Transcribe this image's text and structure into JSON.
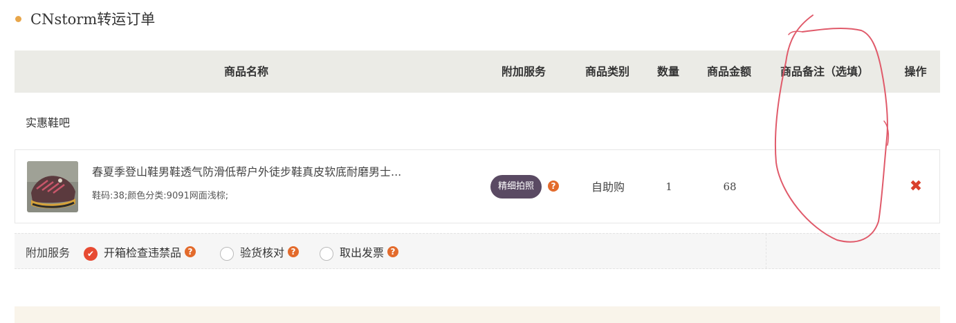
{
  "section": {
    "title": "CNstorm转运订单"
  },
  "table": {
    "headers": {
      "name": "商品名称",
      "service": "附加服务",
      "category": "商品类别",
      "qty": "数量",
      "amount": "商品金额",
      "remark": "商品备注（选填）",
      "action": "操作"
    }
  },
  "shop": {
    "name": "实惠鞋吧"
  },
  "item": {
    "title": "春夏季登山鞋男鞋透气防滑低帮户外徒步鞋真皮软底耐磨男士...",
    "spec": "鞋码:38;颜色分类:9091网面浅棕;",
    "service_badge": "精细拍照",
    "help_glyph": "?",
    "category": "自助购",
    "qty": "1",
    "amount": "68",
    "remark": "",
    "delete_glyph": "✖",
    "thumbnail_icon": "shoe-thumbnail"
  },
  "addon": {
    "label": "附加服务",
    "options": [
      {
        "label": "开箱检查违禁品",
        "checked": true
      },
      {
        "label": "验货核对",
        "checked": false
      },
      {
        "label": "取出发票",
        "checked": false
      }
    ]
  },
  "colors": {
    "accent_dot": "#e8a64a",
    "header_bg": "#ebebe6",
    "badge_bg": "#5a4a63",
    "help_orange": "#e36b2c",
    "delete_red": "#d9402b",
    "radio_checked": "#e74a32",
    "annotation_red": "#e05a6a"
  }
}
